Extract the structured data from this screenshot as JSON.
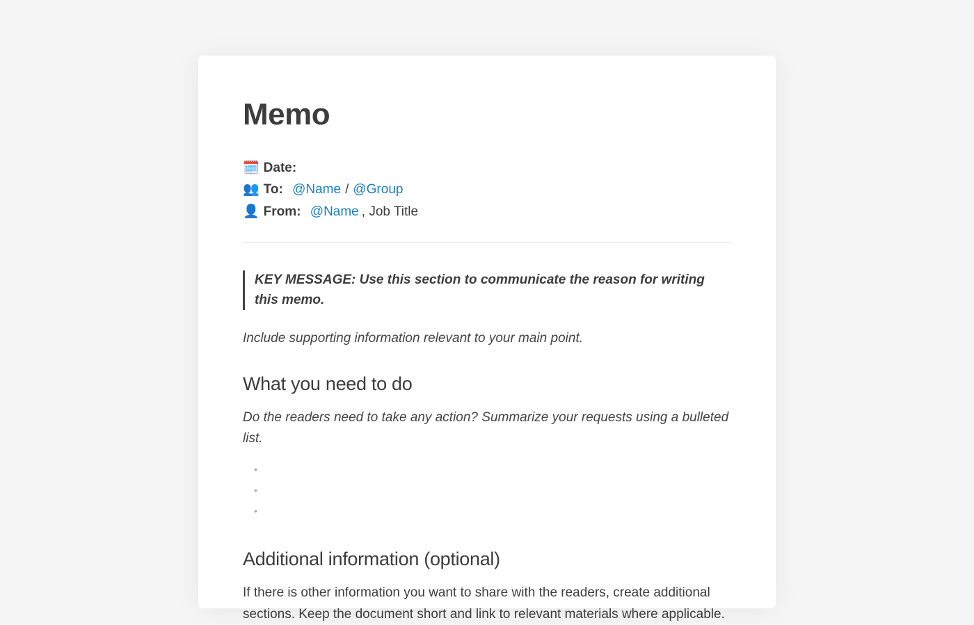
{
  "document": {
    "title": "Memo",
    "meta": {
      "date": {
        "icon": "🗓️",
        "label": "Date:"
      },
      "to": {
        "icon": "👥",
        "label": "To:",
        "mention1": "@Name",
        "separator": "/",
        "mention2": "@Group"
      },
      "from": {
        "icon": "👤",
        "label": "From:",
        "mention": "@Name",
        "suffix": ", Job Title"
      }
    },
    "key_message": "KEY MESSAGE: Use this section to communicate the reason for writing this memo.",
    "supporting_text": "Include supporting information relevant to your main point.",
    "sections": {
      "action": {
        "heading": "What you need to do",
        "prompt": "Do the readers need to take any action? Summarize your requests using a bulleted list.",
        "bullets": [
          "",
          "",
          ""
        ]
      },
      "additional": {
        "heading": "Additional information (optional)",
        "body": "If there is other information you want to share with the readers, create additional sections. Keep the document short and link to relevant materials where applicable."
      }
    }
  }
}
